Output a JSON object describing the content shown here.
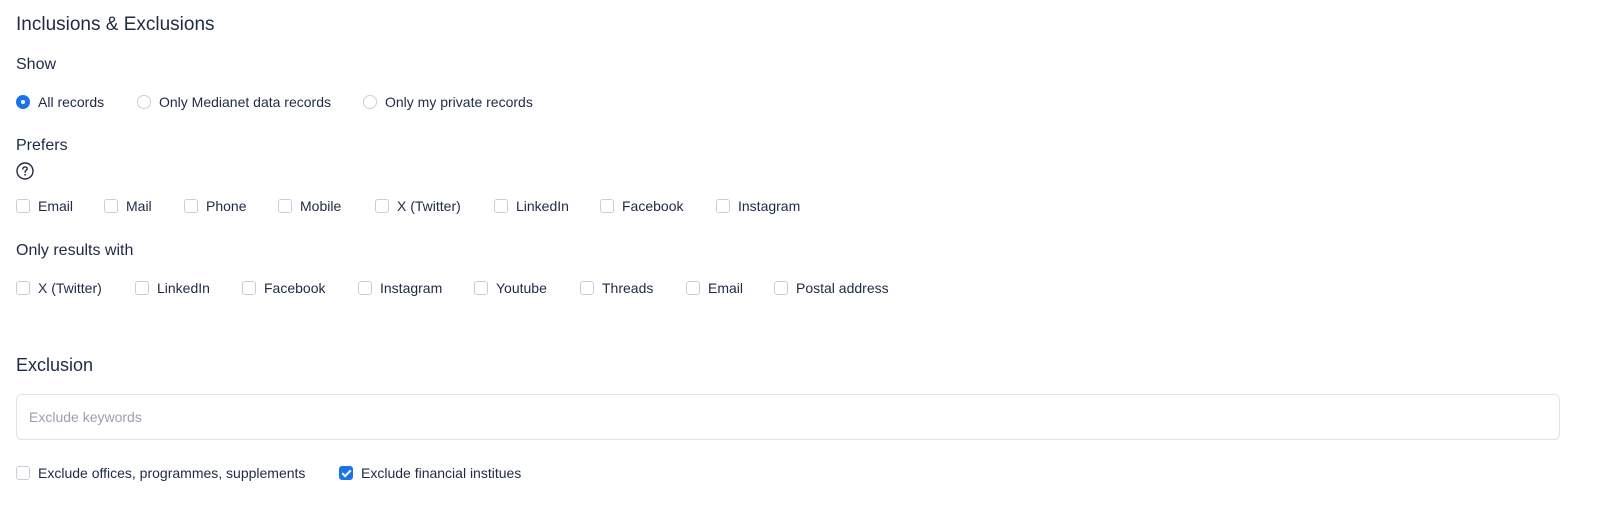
{
  "title": "Inclusions & Exclusions",
  "show": {
    "label": "Show",
    "options": [
      {
        "label": "All records",
        "selected": true
      },
      {
        "label": "Only Medianet data records",
        "selected": false
      },
      {
        "label": "Only my private records",
        "selected": false
      }
    ]
  },
  "prefers": {
    "label": "Prefers",
    "help_icon": "question-circle-icon",
    "options": [
      {
        "label": "Email",
        "checked": false
      },
      {
        "label": "Mail",
        "checked": false
      },
      {
        "label": "Phone",
        "checked": false
      },
      {
        "label": "Mobile",
        "checked": false
      },
      {
        "label": "X (Twitter)",
        "checked": false
      },
      {
        "label": "LinkedIn",
        "checked": false
      },
      {
        "label": "Facebook",
        "checked": false
      },
      {
        "label": "Instagram",
        "checked": false
      }
    ]
  },
  "only_results": {
    "label": "Only results with",
    "options": [
      {
        "label": "X (Twitter)",
        "checked": false
      },
      {
        "label": "LinkedIn",
        "checked": false
      },
      {
        "label": "Facebook",
        "checked": false
      },
      {
        "label": "Instagram",
        "checked": false
      },
      {
        "label": "Youtube",
        "checked": false
      },
      {
        "label": "Threads",
        "checked": false
      },
      {
        "label": "Email",
        "checked": false
      },
      {
        "label": "Postal address",
        "checked": false
      }
    ]
  },
  "exclusion": {
    "label": "Exclusion",
    "keywords": {
      "placeholder": "Exclude keywords",
      "value": ""
    },
    "options": [
      {
        "label": "Exclude offices, programmes, supplements",
        "checked": false
      },
      {
        "label": "Exclude financial institues",
        "checked": true
      }
    ]
  },
  "colors": {
    "accent": "#1a73e8",
    "text": "#1f2a44",
    "border": "#c9ced6",
    "placeholder": "#9aa1ab"
  }
}
